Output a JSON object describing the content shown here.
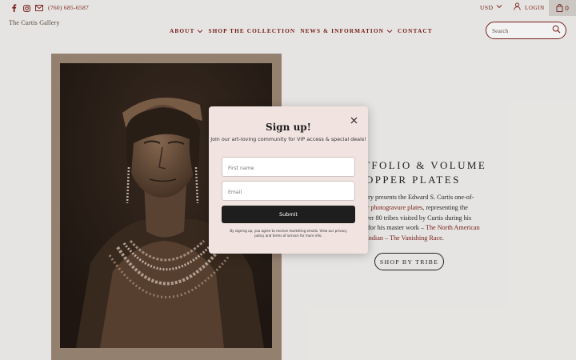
{
  "topbar": {
    "social_icons": [
      "facebook-icon",
      "instagram-icon",
      "email-icon"
    ],
    "phone": "(760) 685-6587",
    "currency": "USD",
    "login_label": "LOGIN",
    "cart_count": "0"
  },
  "header": {
    "logo": "The Curtis Gallery",
    "nav": [
      {
        "label": "ABOUT",
        "has_dropdown": true
      },
      {
        "label": "SHOP THE COLLECTION",
        "has_dropdown": false
      },
      {
        "label": "NEWS & INFORMATION",
        "has_dropdown": true
      },
      {
        "label": "CONTACT",
        "has_dropdown": false
      }
    ],
    "search_placeholder": "Search"
  },
  "hero": {
    "title_line1": "TFOLIO & VOLUME",
    "title_line2": "OPPER PLATES",
    "body_part1": "llery presents the Edward S. Curtis one-of-",
    "body_part2": "er ",
    "body_link1": "photogravure plates",
    "body_part3": ", representing the",
    "body_part4": "ver 80 tribes visited by Curtis during his",
    "body_part5": "for his master work – ",
    "body_link2": "The North American",
    "body_link3": "Indian – The Vanishing Race",
    "body_part6": ".",
    "cta_label": "SHOP BY TRIBE"
  },
  "modal": {
    "title": "Sign up!",
    "subtitle": "Join our art-loving community for VIP access & special deals!",
    "first_name_placeholder": "First name",
    "email_placeholder": "Email",
    "submit_label": "Submit",
    "legal": "By signing up, you agree to receive marketing emails. View our privacy policy and terms of service for more info."
  },
  "colors": {
    "accent": "#7a1d17",
    "modal_bg": "#f1e4e0",
    "button_dark": "#1e1e1e"
  }
}
